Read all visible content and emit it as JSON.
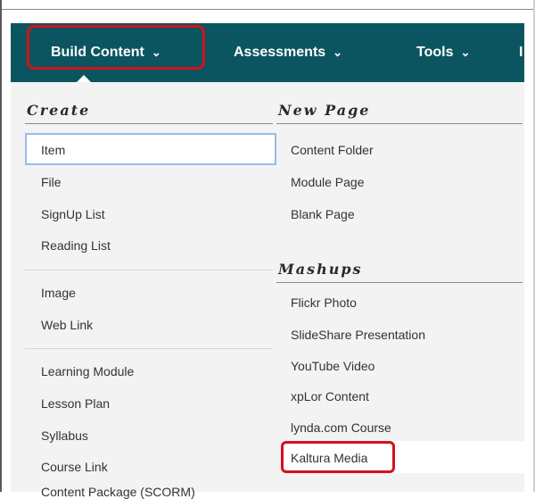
{
  "nav": {
    "items": [
      {
        "label": "Build Content",
        "chevron": "⌄"
      },
      {
        "label": "Assessments",
        "chevron": "⌄"
      },
      {
        "label": "Tools",
        "chevron": "⌄"
      },
      {
        "label": "I"
      }
    ]
  },
  "menu": {
    "create": {
      "heading": "Create",
      "groups": [
        [
          "Item",
          "File",
          "SignUp List",
          "Reading List"
        ],
        [
          "Image",
          "Web Link"
        ],
        [
          "Learning Module",
          "Lesson Plan",
          "Syllabus",
          "Course Link",
          "Content Package (SCORM)"
        ]
      ]
    },
    "new_page": {
      "heading": "New Page",
      "items": [
        "Content Folder",
        "Module Page",
        "Blank Page"
      ]
    },
    "mashups": {
      "heading": "Mashups",
      "items": [
        "Flickr Photo",
        "SlideShare Presentation",
        "YouTube Video",
        "xpLor Content",
        "lynda.com Course",
        "Kaltura Media"
      ]
    }
  },
  "colors": {
    "navbar": "#0b5560",
    "highlight": "#d4111b",
    "menu_bg": "#f3f3f3"
  }
}
